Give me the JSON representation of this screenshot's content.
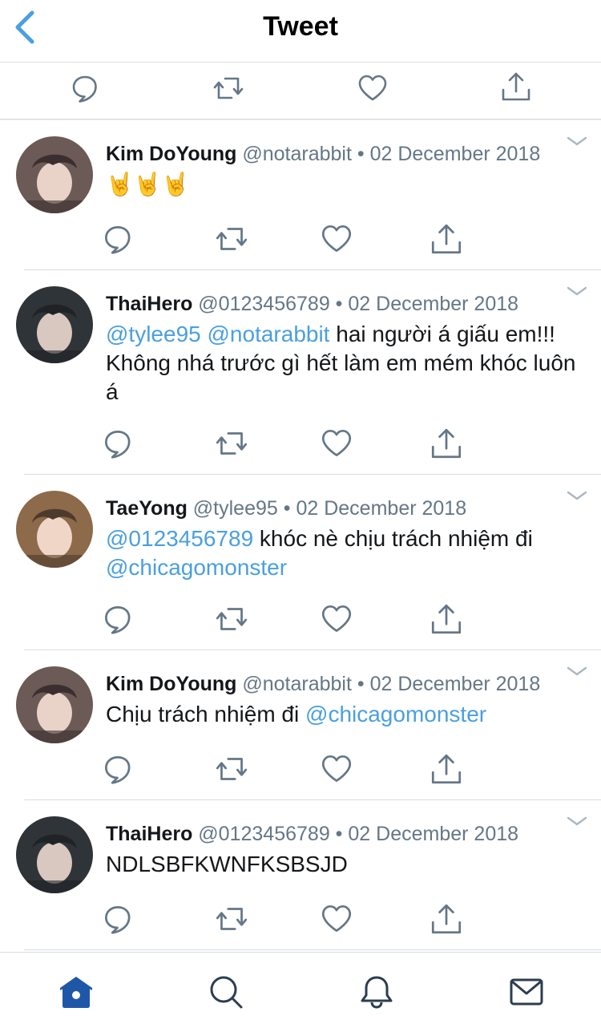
{
  "header": {
    "title": "Tweet",
    "back_icon": "chevron-left-icon",
    "accent_color": "#4a9fe0"
  },
  "top_actions": [
    "reply-icon",
    "retweet-icon",
    "like-icon",
    "share-icon"
  ],
  "tweets": [
    {
      "name": "Kim DoYoung",
      "handle": "@notarabbit",
      "date": "02 December 2018",
      "separator": "•",
      "text_parts": [
        {
          "t": "🤘🤘🤘",
          "mention": false
        }
      ]
    },
    {
      "name": "ThaiHero",
      "handle": "@0123456789",
      "date": "02 December 2018",
      "separator": "•",
      "text_parts": [
        {
          "t": "@tylee95",
          "mention": true
        },
        {
          "t": " ",
          "mention": false
        },
        {
          "t": "@notarabbit",
          "mention": true
        },
        {
          "t": " hai người á giấu em!!! Không nhá trước gì hết làm em mém khóc luôn á",
          "mention": false
        }
      ]
    },
    {
      "name": "TaeYong",
      "handle": "@tylee95",
      "date": "02 December 2018",
      "separator": "•",
      "text_parts": [
        {
          "t": "@0123456789",
          "mention": true
        },
        {
          "t": " khóc nè chịu trách nhiệm đi ",
          "mention": false
        },
        {
          "t": "@chicagomonster",
          "mention": true
        }
      ]
    },
    {
      "name": "Kim DoYoung",
      "handle": "@notarabbit",
      "date": "02 December 2018",
      "separator": "•",
      "text_parts": [
        {
          "t": "Chịu trách nhiệm đi ",
          "mention": false
        },
        {
          "t": "@chicagomonster",
          "mention": true
        }
      ]
    },
    {
      "name": "ThaiHero",
      "handle": "@0123456789",
      "date": "02 December 2018",
      "separator": "•",
      "text_parts": [
        {
          "t": "NDLSBFKWNFKSBSJD",
          "mention": false
        }
      ]
    }
  ],
  "tabbar": {
    "items": [
      "home-icon",
      "search-icon",
      "notifications-icon",
      "messages-icon"
    ],
    "active_color": "#1f57a8",
    "inactive_color": "#2c3e50"
  }
}
